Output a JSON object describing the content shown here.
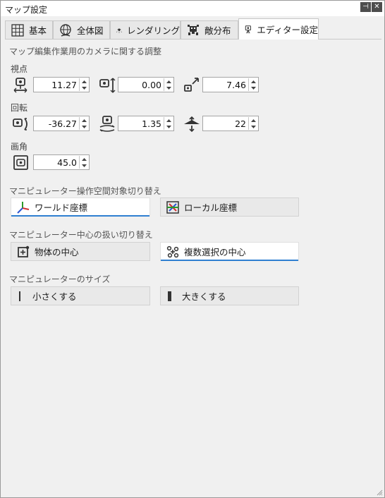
{
  "window": {
    "title": "マップ設定"
  },
  "tabs": [
    {
      "label": "基本",
      "icon": "grid-icon"
    },
    {
      "label": "全体図",
      "icon": "globe-icon"
    },
    {
      "label": "レンダリング",
      "icon": "light-icon"
    },
    {
      "label": "敵分布",
      "icon": "enemy-icon"
    },
    {
      "label": "エディター設定",
      "icon": "camera-person-icon",
      "active": true
    }
  ],
  "camera": {
    "heading": "マップ編集作業用のカメラに関する調整",
    "viewpoint": {
      "label": "視点",
      "fields": [
        {
          "icon": "camera-horizontal-icon",
          "value": "11.27"
        },
        {
          "icon": "camera-vertical-icon",
          "value": "0.00"
        },
        {
          "icon": "zoom-expand-icon",
          "value": "7.46"
        }
      ]
    },
    "rotation": {
      "label": "回転",
      "fields": [
        {
          "icon": "camera-rotate-icon",
          "value": "-36.27"
        },
        {
          "icon": "camera-orbit-icon",
          "value": "1.35"
        },
        {
          "icon": "tilt-icon",
          "value": "22"
        }
      ]
    },
    "fov": {
      "label": "画角",
      "fields": [
        {
          "icon": "camera-fov-icon",
          "value": "45.0"
        }
      ]
    }
  },
  "manip_space": {
    "heading": "マニピュレーター操作空間対象切り替え",
    "world": "ワールド座標",
    "local": "ローカル座標"
  },
  "manip_center": {
    "heading": "マニピュレーター中心の扱い切り替え",
    "object": "物体の中心",
    "selection": "複数選択の中心"
  },
  "manip_size": {
    "heading": "マニピュレーターのサイズ",
    "smaller": "小さくする",
    "bigger": "大きくする"
  },
  "colors": {
    "accent": "#2f7fd1",
    "tab_active": "#ffffff",
    "panel": "#f0f0f0"
  }
}
